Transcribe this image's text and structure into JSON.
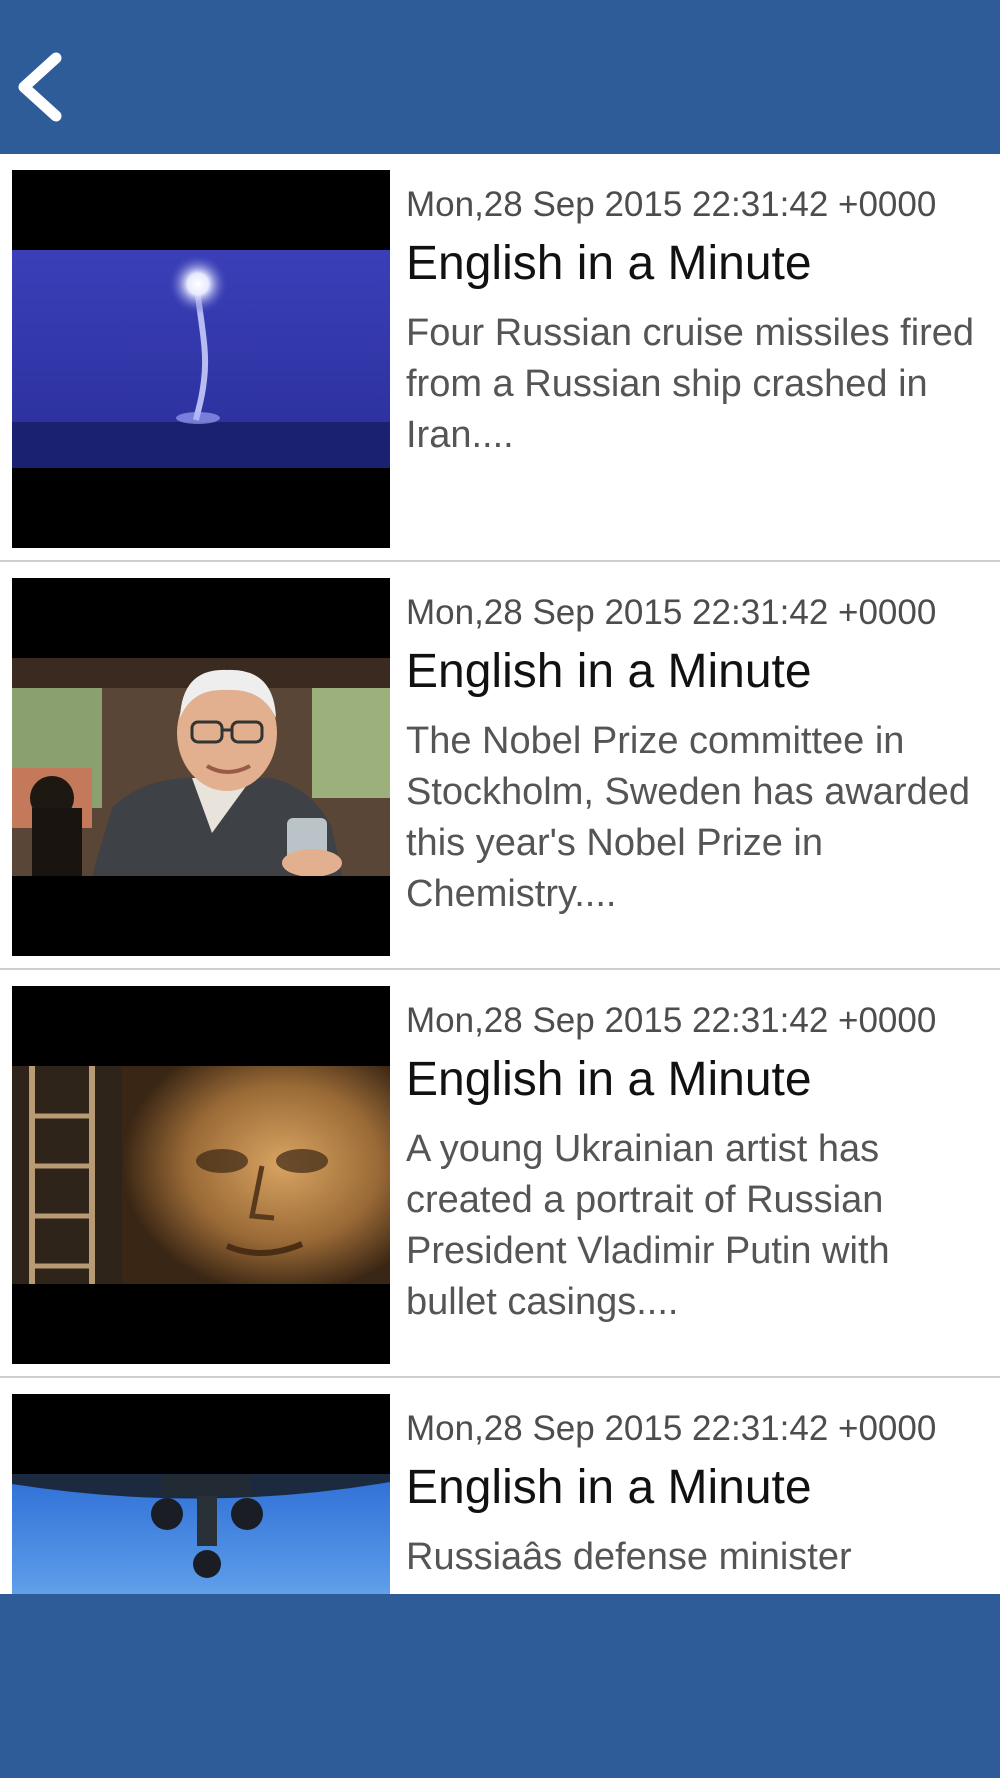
{
  "header": {
    "back_icon": "chevron-left-icon",
    "bg_color": "#2d5c98"
  },
  "articles": [
    {
      "date": "Mon,28 Sep 2015 22:31:42 +0000",
      "title": "English in a Minute",
      "description": "Four Russian cruise missiles fired from a Russian ship crashed in Iran....",
      "thumbnail": "missile-launch-at-sea"
    },
    {
      "date": "Mon,28 Sep 2015 22:31:42 +0000",
      "title": "English in a Minute",
      "description": "The Nobel Prize committee in Stockholm, Sweden has awarded this year's Nobel Prize in Chemistry....",
      "thumbnail": "elderly-man-portrait"
    },
    {
      "date": "Mon,28 Sep 2015 22:31:42 +0000",
      "title": "English in a Minute",
      "description": "A young Ukrainian artist has created a portrait of Russian President Vladimir Putin with bullet casings....",
      "thumbnail": "bullet-casing-portrait"
    },
    {
      "date": "Mon,28 Sep 2015 22:31:42 +0000",
      "title": "English in a Minute",
      "description": "Russiaâs defense minister",
      "thumbnail": "aircraft-over-earth"
    }
  ]
}
